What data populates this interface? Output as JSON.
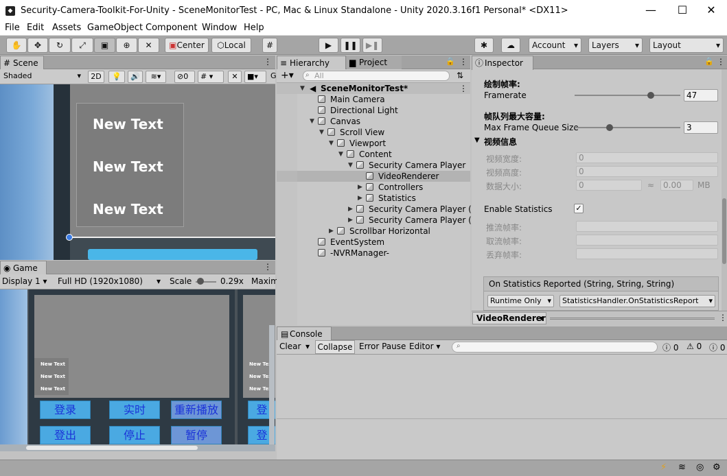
{
  "window": {
    "title": "Security-Camera-Toolkit-For-Unity - SceneMonitorTest - PC, Mac & Linux Standalone - Unity 2020.3.16f1 Personal* <DX11>",
    "minimize": "—",
    "maximize": "☐",
    "close": "✕"
  },
  "menu": [
    "File",
    "Edit",
    "Assets",
    "GameObject",
    "Component",
    "Window",
    "Help"
  ],
  "toolbar": {
    "center_label": "Center",
    "local_label": "Local",
    "account_label": "Account",
    "layers_label": "Layers",
    "layout_label": "Layout"
  },
  "scene": {
    "tab_label": "Scene",
    "shading": "Shaded",
    "mode_2d": "2D",
    "hidden_count": "0",
    "texts": [
      "New Text",
      "New Text",
      "New Text"
    ]
  },
  "game": {
    "tab_label": "Game",
    "display": "Display 1",
    "resolution": "Full HD (1920x1080)",
    "scale_label": "Scale",
    "scale_value": "0.29x",
    "maximize_label": "Maxim",
    "small_texts": [
      "New Text",
      "New Text",
      "New Text"
    ],
    "buttons": [
      "登录",
      "实时",
      "重新播放",
      "登出",
      "停止",
      "暂停"
    ],
    "right_buttons": [
      "登",
      "登"
    ]
  },
  "hierarchy": {
    "tab_label": "Hierarchy",
    "search_placeholder": "All",
    "scene_name": "SceneMonitorTest*",
    "items": [
      {
        "label": "Main Camera",
        "depth": 1,
        "arrow": ""
      },
      {
        "label": "Directional Light",
        "depth": 1,
        "arrow": ""
      },
      {
        "label": "Canvas",
        "depth": 1,
        "arrow": "▼"
      },
      {
        "label": "Scroll View",
        "depth": 2,
        "arrow": "▼"
      },
      {
        "label": "Viewport",
        "depth": 3,
        "arrow": "▼"
      },
      {
        "label": "Content",
        "depth": 4,
        "arrow": "▼"
      },
      {
        "label": "Security Camera Player",
        "depth": 5,
        "arrow": "▼"
      },
      {
        "label": "VideoRenderer",
        "depth": 6,
        "arrow": "",
        "selected": true
      },
      {
        "label": "Controllers",
        "depth": 6,
        "arrow": "▶"
      },
      {
        "label": "Statistics",
        "depth": 6,
        "arrow": "▶"
      },
      {
        "label": "Security Camera Player (1",
        "depth": 5,
        "arrow": "▶"
      },
      {
        "label": "Security Camera Player (2",
        "depth": 5,
        "arrow": "▶"
      },
      {
        "label": "Scrollbar Horizontal",
        "depth": 3,
        "arrow": "▶"
      },
      {
        "label": "EventSystem",
        "depth": 1,
        "arrow": ""
      },
      {
        "label": "-NVRManager-",
        "depth": 1,
        "arrow": ""
      }
    ]
  },
  "project": {
    "tab_label": "Project"
  },
  "inspector": {
    "tab_label": "Inspector",
    "draw_fps_header": "绘制帧率:",
    "framerate_label": "Framerate",
    "framerate_value": "47",
    "framerate_fraction": 0.72,
    "queue_header": "帧队列最大容量:",
    "queue_label": "Max Frame Queue Size",
    "queue_value": "3",
    "queue_fraction": 0.33,
    "video_info_header": "视频信息",
    "video_width_label": "视频宽度:",
    "video_width_value": "0",
    "video_height_label": "视频高度:",
    "video_height_value": "0",
    "data_size_label": "数据大小:",
    "data_size_value": "0",
    "approx": "≈",
    "data_size_mb": "0.00",
    "mb_unit": "MB",
    "enable_stats_label": "Enable Statistics",
    "enable_stats_check": "✓",
    "push_fps_label": "推流帧率:",
    "pull_fps_label": "取流帧率:",
    "drop_fps_label": "丢弃帧率:",
    "event_header": "On Statistics Reported (String, String, String)",
    "runtime_mode": "Runtime Only",
    "handler": "StatisticsHandler.OnStatisticsReport",
    "component_name": "VideoRenderer"
  },
  "console": {
    "tab_label": "Console",
    "clear": "Clear",
    "collapse": "Collapse",
    "error_pause": "Error Pause",
    "editor": "Editor",
    "error_count": "0",
    "warning_count": "0",
    "info_count": "0"
  }
}
